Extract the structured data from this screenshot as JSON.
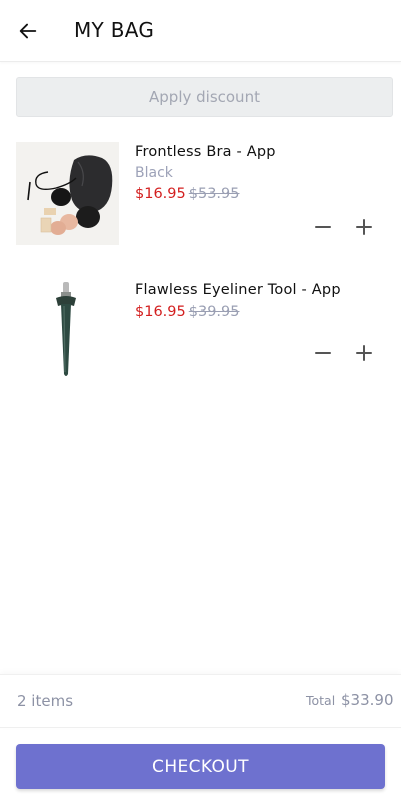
{
  "header": {
    "title": "MY BAG",
    "back_icon": "arrow-left-icon"
  },
  "discount": {
    "label": "Apply discount"
  },
  "cart": {
    "items": [
      {
        "name": "Frontless Bra - App",
        "variant": "Black",
        "price": "$16.95",
        "original_price": "$53.95",
        "image": "frontless-bra-product-image"
      },
      {
        "name": "Flawless Eyeliner Tool - App",
        "price": "$16.95",
        "original_price": "$39.95",
        "image": "eyeliner-tool-product-image"
      }
    ],
    "qty_icons": {
      "minus": "minus-icon",
      "plus": "plus-icon"
    }
  },
  "summary": {
    "items_count": "2 items",
    "total_label": "Total",
    "total_value": "$33.90"
  },
  "checkout": {
    "label": "CHECKOUT"
  },
  "colors": {
    "accent": "#6e71cf",
    "sale_price": "#d31f1f",
    "muted_text": "#9a9fb3",
    "discount_bg": "#eceeef"
  }
}
